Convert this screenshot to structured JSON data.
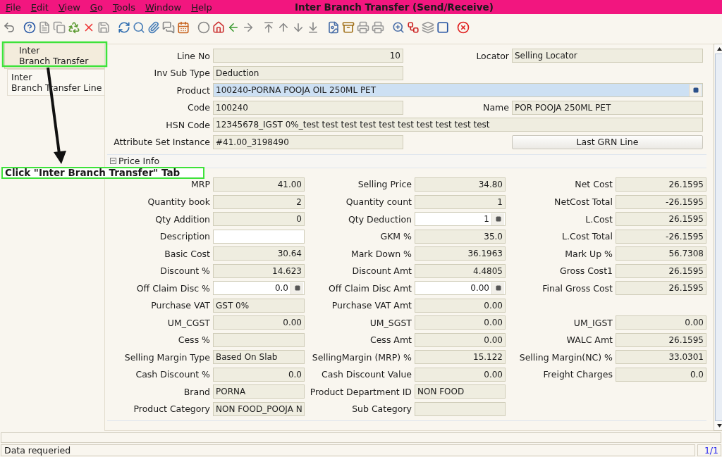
{
  "menu": [
    {
      "label": "File"
    },
    {
      "label": "Edit"
    },
    {
      "label": "View"
    },
    {
      "label": "Go"
    },
    {
      "label": "Tools"
    },
    {
      "label": "Window"
    },
    {
      "label": "Help"
    }
  ],
  "window": {
    "title": "Inter Branch Transfer (Send/Receive)"
  },
  "tabs": [
    {
      "label": "Inter\nBranch Transfer",
      "selected": true
    },
    {
      "label": "Inter\nBranch Transfer Line",
      "selected": false
    }
  ],
  "header_rows": [
    [
      {
        "kind": "readonly",
        "label": "Line No",
        "value": "10",
        "numeric": true
      },
      {
        "kind": "readonly",
        "label": "Locator",
        "value": "Selling Locator",
        "numeric": false
      }
    ],
    [
      {
        "kind": "readonly",
        "label": "Inv Sub Type",
        "value": "Deduction",
        "numeric": false
      },
      null
    ],
    [
      {
        "kind": "lookup",
        "label": "Product",
        "value": "100240-PORNA POOJA OIL 250ML PET",
        "numeric": false,
        "wide": true,
        "focused": true
      }
    ],
    [
      {
        "kind": "readonly",
        "label": "Code",
        "value": "100240",
        "numeric": false
      },
      {
        "kind": "readonly",
        "label": "Name",
        "value": "POR POOJA 250ML PET",
        "numeric": false
      }
    ],
    [
      {
        "kind": "readonly",
        "label": "HSN Code",
        "value": "12345678_IGST 0%_test test test test test test test test test test",
        "numeric": false,
        "wide": true
      }
    ],
    [
      {
        "kind": "readonly",
        "label": "Attribute Set Instance",
        "value": "#41.00_3198490",
        "numeric": false
      },
      {
        "kind": "button",
        "label": "Last GRN Line"
      }
    ]
  ],
  "price_section": {
    "title": "Price Info",
    "expanded": true
  },
  "price_rows": [
    [
      {
        "kind": "readonly",
        "label": "MRP",
        "value": "41.00",
        "numeric": true
      },
      {
        "kind": "readonly",
        "label": "Selling Price",
        "value": "34.80",
        "numeric": true
      },
      {
        "kind": "readonly",
        "label": "Net Cost",
        "value": "26.1595",
        "numeric": true
      }
    ],
    [
      {
        "kind": "readonly",
        "label": "Quantity book",
        "value": "2",
        "numeric": true
      },
      {
        "kind": "readonly",
        "label": "Quantity count",
        "value": "1",
        "numeric": true
      },
      {
        "kind": "readonly",
        "label": "NetCost Total",
        "value": "-26.1595",
        "numeric": true
      }
    ],
    [
      {
        "kind": "readonly",
        "label": "Qty Addition",
        "value": "0",
        "numeric": true
      },
      {
        "kind": "lookup",
        "label": "Qty Deduction",
        "value": "1",
        "numeric": true
      },
      {
        "kind": "readonly",
        "label": "L.Cost",
        "value": "26.1595",
        "numeric": true
      }
    ],
    [
      {
        "kind": "editable",
        "label": "Description"
      },
      {
        "kind": "readonly",
        "label": "GKM %",
        "value": "35.0",
        "numeric": true
      },
      {
        "kind": "readonly",
        "label": "L.Cost Total",
        "value": "-26.1595",
        "numeric": true
      }
    ],
    [
      {
        "kind": "readonly",
        "label": "Basic Cost",
        "value": "30.64",
        "numeric": true
      },
      {
        "kind": "readonly",
        "label": "Mark Down %",
        "value": "36.1963",
        "numeric": true
      },
      {
        "kind": "readonly",
        "label": "Mark Up %",
        "value": "56.7308",
        "numeric": true
      }
    ],
    [
      {
        "kind": "readonly",
        "label": "Discount %",
        "value": "14.623",
        "numeric": true
      },
      {
        "kind": "readonly",
        "label": "Discount Amt",
        "value": "4.4805",
        "numeric": true
      },
      {
        "kind": "readonly",
        "label": "Gross Cost1",
        "value": "26.1595",
        "numeric": true
      }
    ],
    [
      {
        "kind": "lookup",
        "label": "Off Claim Disc %",
        "value": "0.0",
        "numeric": true
      },
      {
        "kind": "lookup",
        "label": "Off Claim Disc Amt",
        "value": "0.00",
        "numeric": true
      },
      {
        "kind": "readonly",
        "label": "Final Gross Cost",
        "value": "26.1595",
        "numeric": true
      }
    ],
    [
      {
        "kind": "readonly",
        "label": "Purchase VAT",
        "value": "GST 0%",
        "numeric": false
      },
      {
        "kind": "readonly",
        "label": "Purchase VAT Amt",
        "value": "0.00",
        "numeric": true
      },
      null
    ],
    [
      {
        "kind": "readonly",
        "label": "UM_CGST",
        "value": "0.00",
        "numeric": true
      },
      {
        "kind": "readonly",
        "label": "UM_SGST",
        "value": "0.00",
        "numeric": true
      },
      {
        "kind": "readonly",
        "label": "UM_IGST",
        "value": "0.00",
        "numeric": true
      }
    ],
    [
      {
        "kind": "readonly",
        "label": "Cess %"
      },
      {
        "kind": "readonly",
        "label": "Cess Amt",
        "value": "0.00",
        "numeric": true
      },
      {
        "kind": "readonly",
        "label": "WALC Amt",
        "value": "26.1595",
        "numeric": true
      }
    ],
    [
      {
        "kind": "readonly",
        "label": "Selling Margin Type",
        "value": "Based On Slab",
        "numeric": false
      },
      {
        "kind": "readonly",
        "label": "SellingMargin (MRP) %",
        "value": "15.122",
        "numeric": true
      },
      {
        "kind": "readonly",
        "label": "Selling Margin(NC) %",
        "value": "33.0301",
        "numeric": true
      }
    ],
    [
      {
        "kind": "readonly",
        "label": "Cash Discount %",
        "value": "0.0",
        "numeric": true
      },
      {
        "kind": "readonly",
        "label": "Cash Discount Value",
        "value": "0.00",
        "numeric": true
      },
      {
        "kind": "readonly",
        "label": "Freight Charges",
        "value": "0.0",
        "numeric": true
      }
    ],
    [
      {
        "kind": "readonly",
        "label": "Brand",
        "value": "PORNA",
        "numeric": false
      },
      {
        "kind": "readonly",
        "label": "Product Department ID",
        "value": "NON FOOD",
        "numeric": false
      },
      null
    ],
    [
      {
        "kind": "readonly",
        "label": "Product Category",
        "value": "NON FOOD_POOJA N"
      },
      {
        "kind": "readonly",
        "label": "Sub Category"
      },
      null
    ]
  ],
  "annotation": {
    "text": "Click \"Inter Branch Transfer\" Tab"
  },
  "status_bar": {
    "message": "Data requeried",
    "record": "1/1"
  }
}
